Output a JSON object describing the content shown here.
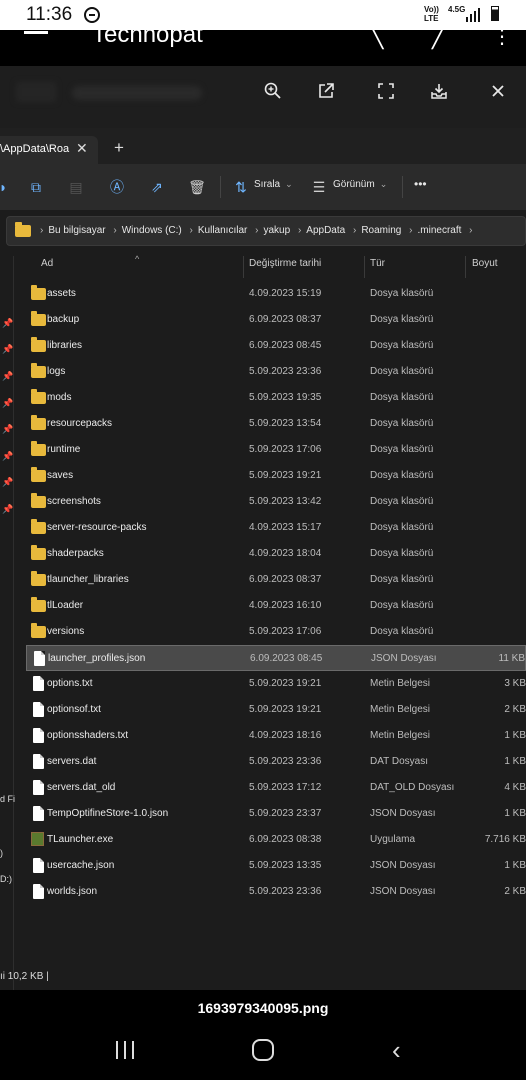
{
  "status_bar": {
    "time": "11:36",
    "network_1": "Vo))",
    "network_2": "LTE",
    "network_3": "4.5G"
  },
  "app_bar": {
    "title": "Technopat"
  },
  "viewer_toolbar": {
    "zoom": "zoom-in-icon",
    "open": "open-external-icon",
    "fullscreen": "fullscreen-icon",
    "save": "download-icon",
    "close": "close-icon"
  },
  "explorer": {
    "tab_title": "\\AppData\\Roa",
    "commands": {
      "sort_label": "Sırala",
      "view_label": "Görünüm",
      "more": "•••"
    },
    "breadcrumbs": [
      "Bu bilgisayar",
      "Windows (C:)",
      "Kullanıcılar",
      "yakup",
      "AppData",
      "Roaming",
      ".minecraft"
    ],
    "columns": {
      "name": "Ad",
      "date": "Değiştirme tarihi",
      "type": "Tür",
      "size": "Boyut"
    },
    "rail_texts": [
      "d Fi",
      ")",
      "D:)"
    ],
    "files": [
      {
        "name": "assets",
        "date": "4.09.2023 15:19",
        "type": "Dosya klasörü",
        "size": "",
        "kind": "folder"
      },
      {
        "name": "backup",
        "date": "6.09.2023 08:37",
        "type": "Dosya klasörü",
        "size": "",
        "kind": "folder"
      },
      {
        "name": "libraries",
        "date": "6.09.2023 08:45",
        "type": "Dosya klasörü",
        "size": "",
        "kind": "folder"
      },
      {
        "name": "logs",
        "date": "5.09.2023 23:36",
        "type": "Dosya klasörü",
        "size": "",
        "kind": "folder"
      },
      {
        "name": "mods",
        "date": "5.09.2023 19:35",
        "type": "Dosya klasörü",
        "size": "",
        "kind": "folder"
      },
      {
        "name": "resourcepacks",
        "date": "5.09.2023 13:54",
        "type": "Dosya klasörü",
        "size": "",
        "kind": "folder"
      },
      {
        "name": "runtime",
        "date": "5.09.2023 17:06",
        "type": "Dosya klasörü",
        "size": "",
        "kind": "folder"
      },
      {
        "name": "saves",
        "date": "5.09.2023 19:21",
        "type": "Dosya klasörü",
        "size": "",
        "kind": "folder"
      },
      {
        "name": "screenshots",
        "date": "5.09.2023 13:42",
        "type": "Dosya klasörü",
        "size": "",
        "kind": "folder"
      },
      {
        "name": "server-resource-packs",
        "date": "4.09.2023 15:17",
        "type": "Dosya klasörü",
        "size": "",
        "kind": "folder"
      },
      {
        "name": "shaderpacks",
        "date": "4.09.2023 18:04",
        "type": "Dosya klasörü",
        "size": "",
        "kind": "folder"
      },
      {
        "name": "tlauncher_libraries",
        "date": "6.09.2023 08:37",
        "type": "Dosya klasörü",
        "size": "",
        "kind": "folder"
      },
      {
        "name": "tlLoader",
        "date": "4.09.2023 16:10",
        "type": "Dosya klasörü",
        "size": "",
        "kind": "folder"
      },
      {
        "name": "versions",
        "date": "5.09.2023 17:06",
        "type": "Dosya klasörü",
        "size": "",
        "kind": "folder"
      },
      {
        "name": "launcher_profiles.json",
        "date": "6.09.2023 08:45",
        "type": "JSON Dosyası",
        "size": "11 KB",
        "kind": "file",
        "selected": true
      },
      {
        "name": "options.txt",
        "date": "5.09.2023 19:21",
        "type": "Metin Belgesi",
        "size": "3 KB",
        "kind": "file"
      },
      {
        "name": "optionsof.txt",
        "date": "5.09.2023 19:21",
        "type": "Metin Belgesi",
        "size": "2 KB",
        "kind": "file"
      },
      {
        "name": "optionsshaders.txt",
        "date": "4.09.2023 18:16",
        "type": "Metin Belgesi",
        "size": "1 KB",
        "kind": "file"
      },
      {
        "name": "servers.dat",
        "date": "5.09.2023 23:36",
        "type": "DAT Dosyası",
        "size": "1 KB",
        "kind": "file"
      },
      {
        "name": "servers.dat_old",
        "date": "5.09.2023 17:12",
        "type": "DAT_OLD Dosyası",
        "size": "4 KB",
        "kind": "file"
      },
      {
        "name": "TempOptifineStore-1.0.json",
        "date": "5.09.2023 23:37",
        "type": "JSON Dosyası",
        "size": "1 KB",
        "kind": "file"
      },
      {
        "name": "TLauncher.exe",
        "date": "6.09.2023 08:38",
        "type": "Uygulama",
        "size": "7.716 KB",
        "kind": "exe"
      },
      {
        "name": "usercache.json",
        "date": "5.09.2023 13:35",
        "type": "JSON Dosyası",
        "size": "1 KB",
        "kind": "file"
      },
      {
        "name": "worlds.json",
        "date": "5.09.2023 23:36",
        "type": "JSON Dosyası",
        "size": "2 KB",
        "kind": "file"
      }
    ],
    "status_text": "ıi  10,2 KB   |"
  },
  "caption": {
    "filename": "1693979340095.png"
  }
}
